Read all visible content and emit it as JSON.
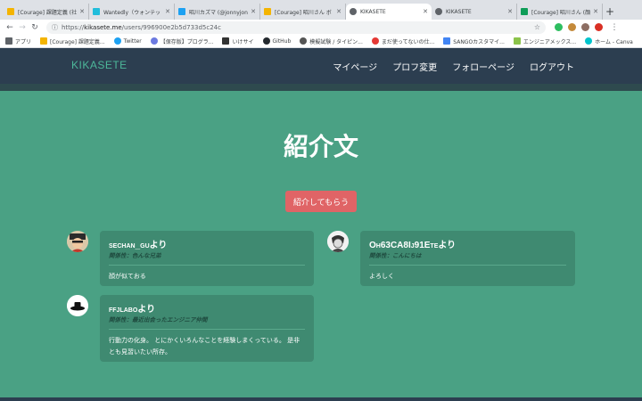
{
  "browser": {
    "tabs": [
      {
        "title": "[Courage] 課題定義 (社",
        "color": "#f4b400",
        "active": false
      },
      {
        "title": "Wantedly（ウォンテッ",
        "color": "#21bddb",
        "active": false
      },
      {
        "title": "昭川カズマ (@jonnyjon",
        "color": "#1da1f2",
        "active": false
      },
      {
        "title": "[Courage] 昭川さん ボ",
        "color": "#f4b400",
        "active": false
      },
      {
        "title": "KIKASETE",
        "color": "#5f6368",
        "active": true
      },
      {
        "title": "KIKASETE",
        "color": "#5f6368",
        "active": false
      },
      {
        "title": "[Courage] 昭川さん (顔",
        "color": "#0f9d58",
        "active": false
      }
    ],
    "url_prefix": "https://",
    "url_host": "kikasete.me",
    "url_path": "/users/996900e2b5d733d5c24c",
    "bookmarks": [
      {
        "label": "アプリ",
        "color": "#5f6368"
      },
      {
        "label": "[Courage] 課題定義...",
        "color": "#f4b400"
      },
      {
        "label": "Twitter",
        "color": "#1da1f2"
      },
      {
        "label": "【保存版】プログラ...",
        "color": "#6c7ae0"
      },
      {
        "label": "いけサイ",
        "color": "#333333"
      },
      {
        "label": "GitHub",
        "color": "#24292e"
      },
      {
        "label": "模擬試験 / タイピン...",
        "color": "#555555"
      },
      {
        "label": "まだ使ってないの仕...",
        "color": "#e53935"
      },
      {
        "label": "SANGOカスタマイ...",
        "color": "#4285f4"
      },
      {
        "label": "エンジニアメックス...",
        "color": "#8bc34a"
      },
      {
        "label": "ホーム - Canva",
        "color": "#00c4cc"
      }
    ]
  },
  "site": {
    "brand": "KIKASETE",
    "nav": [
      "マイページ",
      "プロフ変更",
      "フォローページ",
      "ログアウト"
    ],
    "page_title": "紹介文",
    "cta_label": "紹介してもらう",
    "colors": {
      "bg": "#4aa184",
      "nav": "#2c3e50",
      "card": "#3f8a71",
      "cta": "#e06466",
      "brand": "#4db89a"
    }
  },
  "cards": [
    {
      "from": "sechan_guより",
      "relation": "関係性：色んな兄弟",
      "message": "顔が似ておる"
    },
    {
      "from": "Oh63CA8Ij91Eteより",
      "relation": "関係性：こんにちは",
      "message": "よろしく"
    },
    {
      "from": "ffjlaboより",
      "relation": "関係性：最近出会ったエンジニア仲間",
      "message": "行動力の化身。 とにかくいろんなことを経験しまくっている。 是非とも見習いたい所存。"
    }
  ]
}
